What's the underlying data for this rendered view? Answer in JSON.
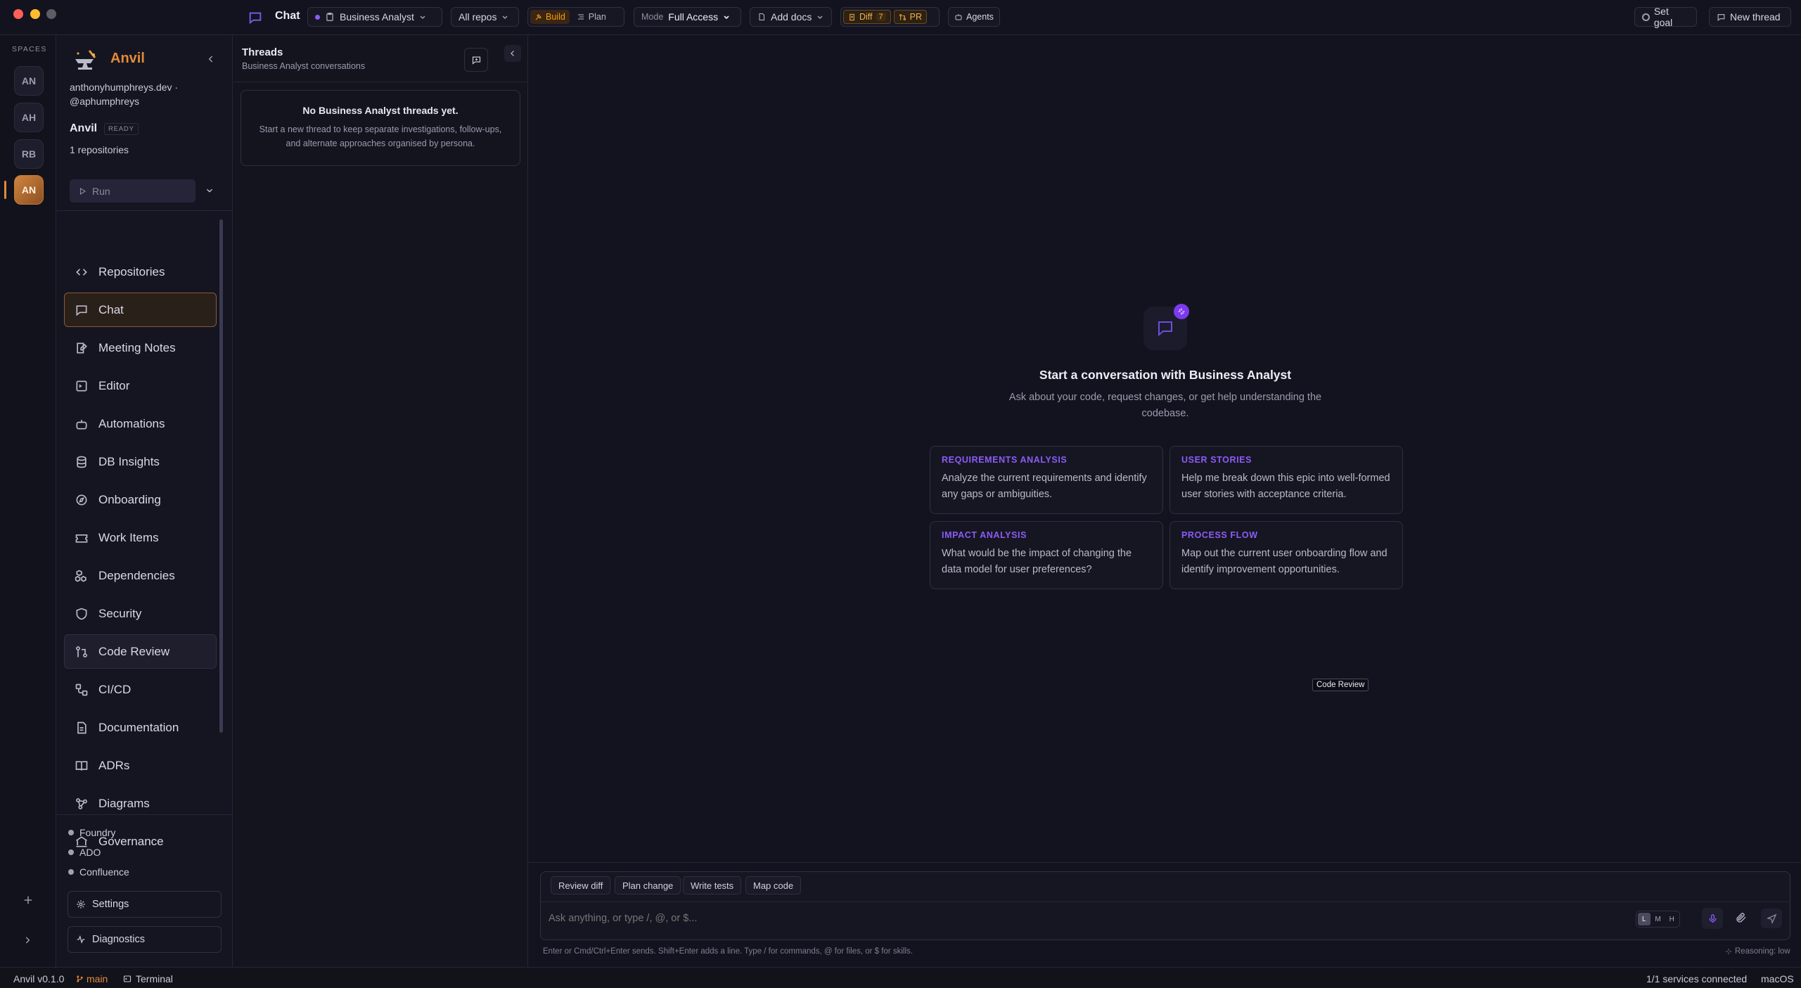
{
  "topbar": {
    "page_title": "Chat",
    "persona": "Business Analyst",
    "repos": "All repos",
    "build_label": "Build",
    "plan_label": "Plan",
    "mode_label": "Mode",
    "mode_value": "Full Access",
    "add_docs": "Add docs",
    "diff_label": "Diff",
    "diff_count": "7",
    "pr_label": "PR",
    "agents_label": "Agents",
    "set_goal": "Set goal",
    "new_thread": "New thread",
    "accent": "#f59e0b"
  },
  "rail": {
    "title": "SPACES",
    "spaces": [
      "AN",
      "AH",
      "RB",
      "AN"
    ]
  },
  "sidebar": {
    "app_name": "Anvil",
    "account": "anthonyhumphreys.dev · @aphumphreys",
    "workspace": "Anvil",
    "status_badge": "READY",
    "repo_count": "1 repositories",
    "run_label": "Run",
    "nav": [
      {
        "label": "Repositories",
        "icon": "code-icon"
      },
      {
        "label": "Chat",
        "icon": "chat-icon"
      },
      {
        "label": "Meeting Notes",
        "icon": "note-icon"
      },
      {
        "label": "Editor",
        "icon": "terminal-icon"
      },
      {
        "label": "Automations",
        "icon": "bot-icon"
      },
      {
        "label": "DB Insights",
        "icon": "database-icon"
      },
      {
        "label": "Onboarding",
        "icon": "compass-icon"
      },
      {
        "label": "Work Items",
        "icon": "ticket-icon"
      },
      {
        "label": "Dependencies",
        "icon": "boxes-icon"
      },
      {
        "label": "Security",
        "icon": "shield-icon"
      },
      {
        "label": "Code Review",
        "icon": "git-pull-icon"
      },
      {
        "label": "CI/CD",
        "icon": "workflow-icon"
      },
      {
        "label": "Documentation",
        "icon": "document-icon"
      },
      {
        "label": "ADRs",
        "icon": "book-icon"
      },
      {
        "label": "Diagrams",
        "icon": "diagram-icon"
      },
      {
        "label": "Governance",
        "icon": "landmark-icon"
      }
    ],
    "integrations": [
      "Foundry",
      "ADO",
      "Confluence"
    ],
    "settings": "Settings",
    "diagnostics": "Diagnostics"
  },
  "threads": {
    "title": "Threads",
    "subtitle": "Business Analyst conversations",
    "empty_title": "No Business Analyst threads yet.",
    "empty_body": "Start a new thread to keep separate investigations, follow-ups, and alternate approaches organised by persona."
  },
  "main": {
    "heading": "Start a conversation with Business Analyst",
    "subheading": "Ask about your code, request changes, or get help understanding the codebase.",
    "cards": [
      {
        "title": "REQUIREMENTS ANALYSIS",
        "body": "Analyze the current requirements and identify any gaps or ambiguities."
      },
      {
        "title": "USER STORIES",
        "body": "Help me break down this epic into well-formed user stories with acceptance criteria."
      },
      {
        "title": "IMPACT ANALYSIS",
        "body": "What would be the impact of changing the data model for user preferences?"
      },
      {
        "title": "PROCESS FLOW",
        "body": "Map out the current user onboarding flow and identify improvement opportunities."
      }
    ],
    "tooltip": "Code Review",
    "quick_actions": [
      "Review diff",
      "Plan change",
      "Write tests",
      "Map code"
    ],
    "input_placeholder": "Ask anything, or type /, @, or $...",
    "sizes": [
      "L",
      "M",
      "H"
    ],
    "hint": "Enter or Cmd/Ctrl+Enter sends. Shift+Enter adds a line. Type / for commands, @ for files, or $ for skills.",
    "reasoning": "Reasoning: low"
  },
  "statusbar": {
    "version": "Anvil v0.1.0",
    "branch": "main",
    "terminal": "Terminal",
    "services": "1/1 services connected",
    "os": "macOS"
  }
}
